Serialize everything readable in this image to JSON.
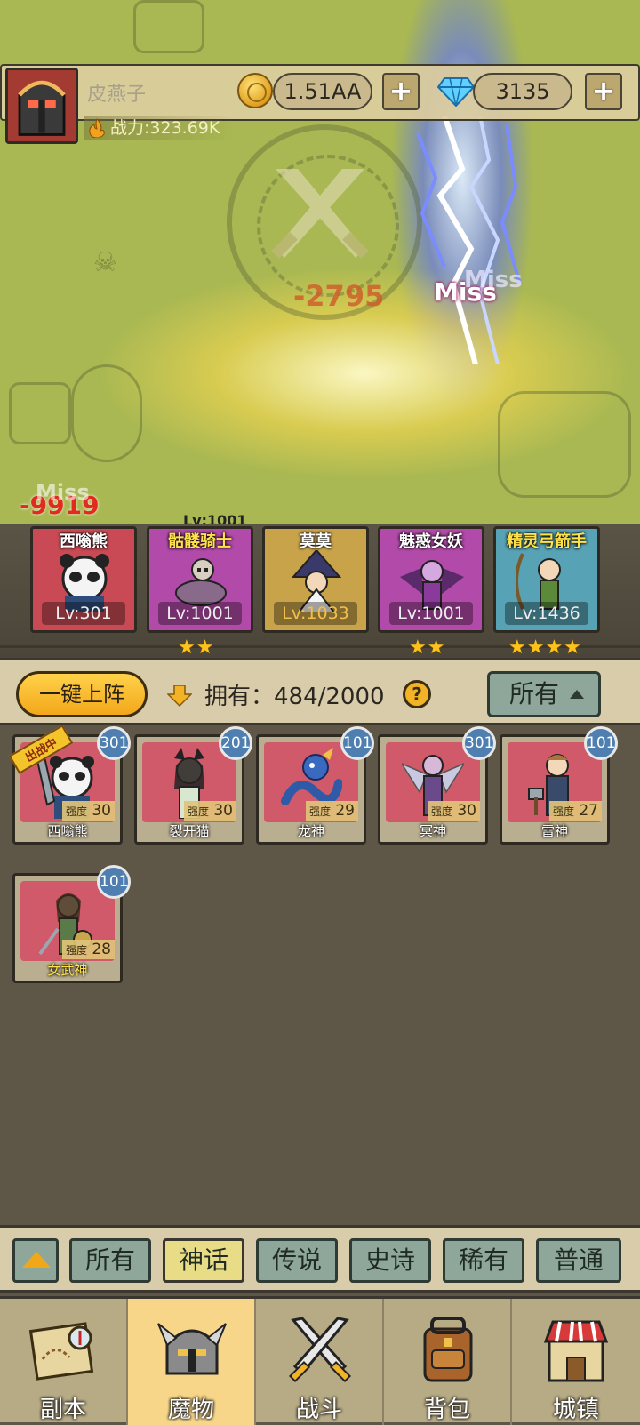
{
  "player": {
    "name": "皮燕子",
    "power_label": "战力:323.69K",
    "coins": "1.51AA",
    "gems": "3135",
    "add_label": "+"
  },
  "battle": {
    "damage_numbers": [
      "-9919",
      "-2795"
    ],
    "miss_texts": [
      "Miss",
      "Miss",
      "Miss"
    ],
    "boss_level": "Lv:1001"
  },
  "lineup": [
    {
      "name": "西嗡熊",
      "level": "Lv:301",
      "stars": "",
      "color": "#c94a55"
    },
    {
      "name": "骷髅骑士",
      "level": "Lv:1001",
      "stars": "★★",
      "color": "#b14aa8"
    },
    {
      "name": "莫莫",
      "level": "Lv:1033",
      "stars": "",
      "color": "#c9a34a"
    },
    {
      "name": "魅惑女妖",
      "level": "Lv:1001",
      "stars": "★★",
      "color": "#b14aa8"
    },
    {
      "name": "精灵弓箭手",
      "level": "Lv:1436",
      "stars": "★★★★",
      "color": "#57a3b5"
    }
  ],
  "controls": {
    "auto_deploy": "一键上阵",
    "owned": "拥有：484/2000",
    "help": "?",
    "filter": "所有"
  },
  "monsters": [
    {
      "name": "西嗡熊",
      "strength_label": "强度",
      "strength": "30",
      "level": "301",
      "tag": "出战中"
    },
    {
      "name": "裂开猫",
      "strength_label": "强度",
      "strength": "30",
      "level": "201",
      "tag": ""
    },
    {
      "name": "龙神",
      "strength_label": "强度",
      "strength": "29",
      "level": "101",
      "tag": ""
    },
    {
      "name": "冥神",
      "strength_label": "强度",
      "strength": "30",
      "level": "301",
      "tag": ""
    },
    {
      "name": "雷神",
      "strength_label": "强度",
      "strength": "27",
      "level": "101",
      "tag": ""
    },
    {
      "name": "女武神",
      "strength_label": "强度",
      "strength": "28",
      "level": "101",
      "tag": ""
    }
  ],
  "rarity_tabs": [
    "所有",
    "神话",
    "传说",
    "史诗",
    "稀有",
    "普通"
  ],
  "rarity_active": "神话",
  "nav": [
    "副本",
    "魔物",
    "战斗",
    "背包",
    "城镇"
  ],
  "nav_active": "魔物"
}
